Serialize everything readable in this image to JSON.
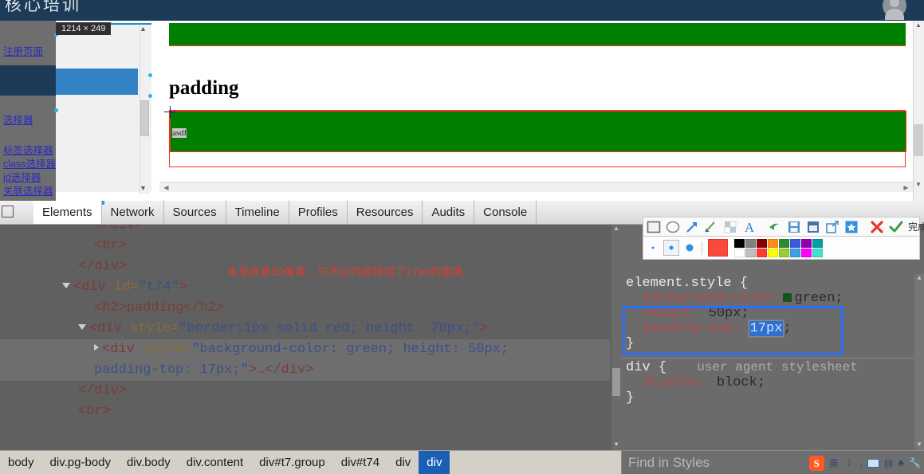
{
  "page": {
    "site_title": "核心培训",
    "size_tooltip": "1214 × 249",
    "heading": "padding",
    "inner_text": "asdf",
    "nav_links": [
      "注册页面",
      "选择器",
      "标签选择器",
      "class选择器",
      "id选择器",
      "关联选择器"
    ]
  },
  "devtools": {
    "tabs": [
      {
        "label": "Elements",
        "active": true
      },
      {
        "label": "Network",
        "active": false
      },
      {
        "label": "Sources",
        "active": false
      },
      {
        "label": "Timeline",
        "active": false
      },
      {
        "label": "Profiles",
        "active": false
      },
      {
        "label": "Resources",
        "active": false
      },
      {
        "label": "Audits",
        "active": false
      },
      {
        "label": "Console",
        "active": false
      }
    ],
    "dom_lines": {
      "l1": "</div>",
      "l2": "<br>",
      "l3": "</div>",
      "l4_tag_open": "<div ",
      "l4_attr": "id=",
      "l4_val": "\"t74\"",
      "l4_close": ">",
      "l5": "<h2>padding</h2>",
      "l6_open": "<div ",
      "l6_attr": "style=",
      "l6_val": "\"border:1px solid red; height: 70px;\"",
      "l6_close": ">",
      "l7_open": "<div ",
      "l7_attr": "style=",
      "l7_val": "\"background-color: green; height: 50px;",
      "l7_val2": "padding-top: 17px;\"",
      "l7_close": ">…</div>",
      "l8": "</div>",
      "l9": "<br>"
    },
    "red_note": "本身还是50像素，只不过内部增加了17px的距离",
    "breadcrumb": [
      {
        "label": "body",
        "active": false
      },
      {
        "label": "div.pg-body",
        "active": false
      },
      {
        "label": "div.body",
        "active": false
      },
      {
        "label": "div.content",
        "active": false
      },
      {
        "label": "div#t7.group",
        "active": false
      },
      {
        "label": "div#t74",
        "active": false
      },
      {
        "label": "div",
        "active": false
      },
      {
        "label": "div",
        "active": true
      }
    ],
    "styles": {
      "rule1_selector": "element.style {",
      "rule1_close": "}",
      "prop_bg_name": "background-color:",
      "prop_bg_value": "green;",
      "prop_height_name": "height:",
      "prop_height_value": "50px;",
      "prop_padding_name": "padding-top:",
      "prop_padding_value": "17px",
      "prop_padding_semi": ";",
      "rule2_selector": "div {",
      "rule2_source": "user agent stylesheet",
      "rule2_close": "}",
      "prop_display_name": "display:",
      "prop_display_value": "block;"
    },
    "find_placeholder": "Find in Styles"
  },
  "annotation_toolbar": {
    "tools": [
      {
        "name": "rectangle-tool",
        "glyph": "▭"
      },
      {
        "name": "ellipse-tool",
        "glyph": "◯"
      },
      {
        "name": "arrow-tool",
        "glyph": "↗"
      },
      {
        "name": "brush-tool",
        "glyph": "✎"
      },
      {
        "name": "mosaic-tool",
        "glyph": "▨"
      },
      {
        "name": "text-tool",
        "glyph": "A"
      },
      {
        "name": "undo-button",
        "glyph": "↶"
      },
      {
        "name": "save-button",
        "glyph": "▤"
      },
      {
        "name": "pin-button",
        "glyph": "▥"
      },
      {
        "name": "share-button",
        "glyph": "⇱"
      },
      {
        "name": "favorite-button",
        "glyph": "★"
      },
      {
        "name": "cancel-button",
        "glyph": "✕"
      },
      {
        "name": "confirm-button",
        "glyph": "✓"
      }
    ],
    "done_label": "完成",
    "current_color": "#fb4a3c",
    "swatches_row1": [
      "#000000",
      "#808080",
      "#8b0000",
      "#ff8c1a",
      "#2e8b2e",
      "#3b5bdb",
      "#8b00b5",
      "#00a0a0"
    ],
    "swatches_row2": [
      "#ffffff",
      "#c0c0c0",
      "#ff3b30",
      "#ffff00",
      "#9acd32",
      "#3fa0e8",
      "#ff00ff",
      "#40e0d0"
    ]
  },
  "ime": {
    "logo": "S",
    "mode": "英"
  }
}
